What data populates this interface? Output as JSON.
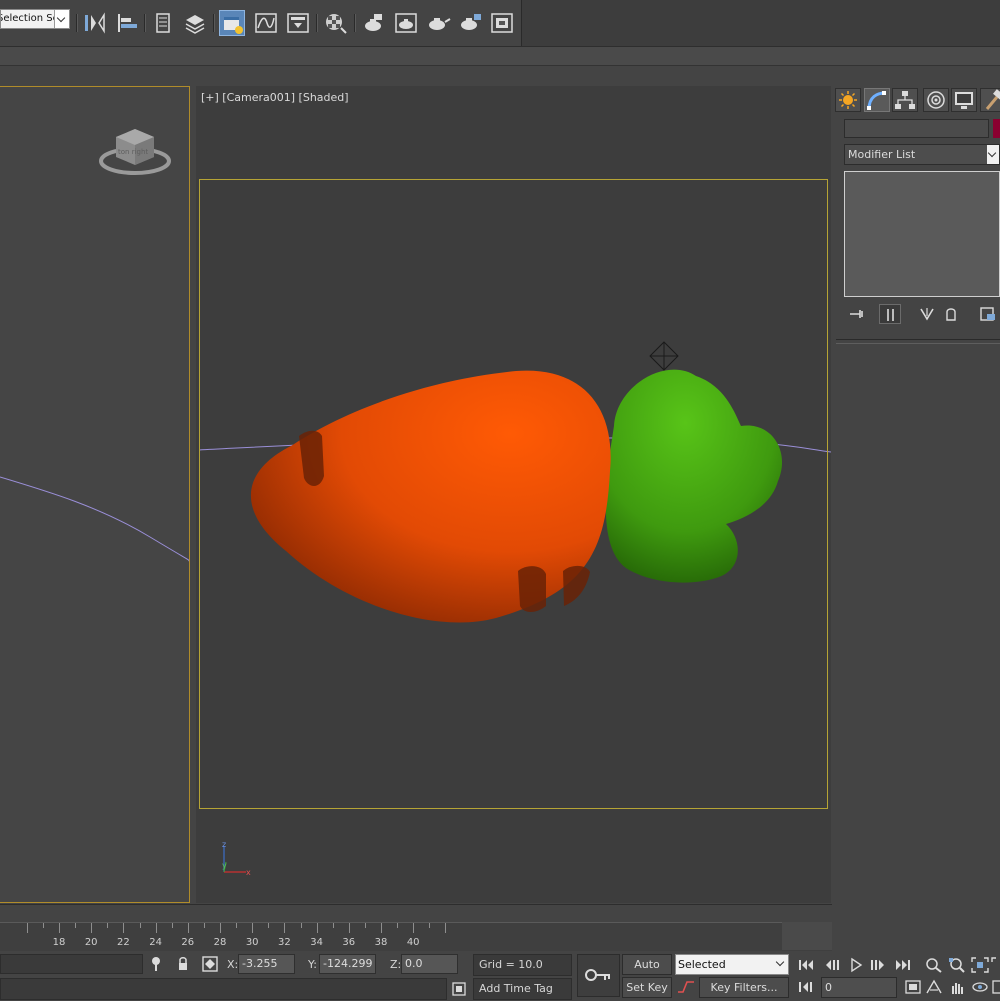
{
  "toolbar": {
    "selection_set": "Selection Se",
    "icons": [
      "mirror-icon",
      "align-icon",
      "scene-explorer-icon",
      "layer-explorer-icon",
      "toggle-ribbon-icon",
      "curve-editor-icon",
      "schematic-view-icon",
      "material-editor-icon",
      "render-setup-icon",
      "rendered-frame-window-icon",
      "render-production-icon",
      "render-iterative-icon",
      "render-activeshade-icon",
      "render-to-texture-icon"
    ]
  },
  "viewport": {
    "label": "[+] [Camera001] [Shaded]",
    "viewcube_text": "ton right",
    "axis_z": "z",
    "axis_y": "y",
    "axis_x": "x"
  },
  "command_panel": {
    "tabs": [
      "create-tab",
      "modify-tab",
      "hierarchy-tab",
      "motion-tab",
      "display-tab",
      "utilities-tab"
    ],
    "object_name": "",
    "object_color": "#8a0030",
    "modifier_list": "Modifier List"
  },
  "timeline": {
    "ticks": [
      "18",
      "20",
      "22",
      "24",
      "26",
      "28",
      "30",
      "32",
      "34",
      "36",
      "38",
      "40"
    ]
  },
  "status": {
    "x_label": "X:",
    "x_value": "-3.255",
    "y_label": "Y:",
    "y_value": "-124.299",
    "z_label": "Z:",
    "z_value": "0.0",
    "grid": "Grid = 10.0",
    "add_time_tag": "Add Time Tag",
    "auto_key": "Auto Key",
    "set_key": "Set Key",
    "key_mode": "Selected",
    "key_filters": "Key Filters...",
    "current_frame": "0"
  },
  "colors": {
    "carrot_body": "#e24a05",
    "carrot_leaves": "#3f9a0f",
    "viewport_bg": "#3d3d3d",
    "active_border": "#b08c2a",
    "safe_frame": "#b6a435",
    "accent": "#5a86b8"
  }
}
